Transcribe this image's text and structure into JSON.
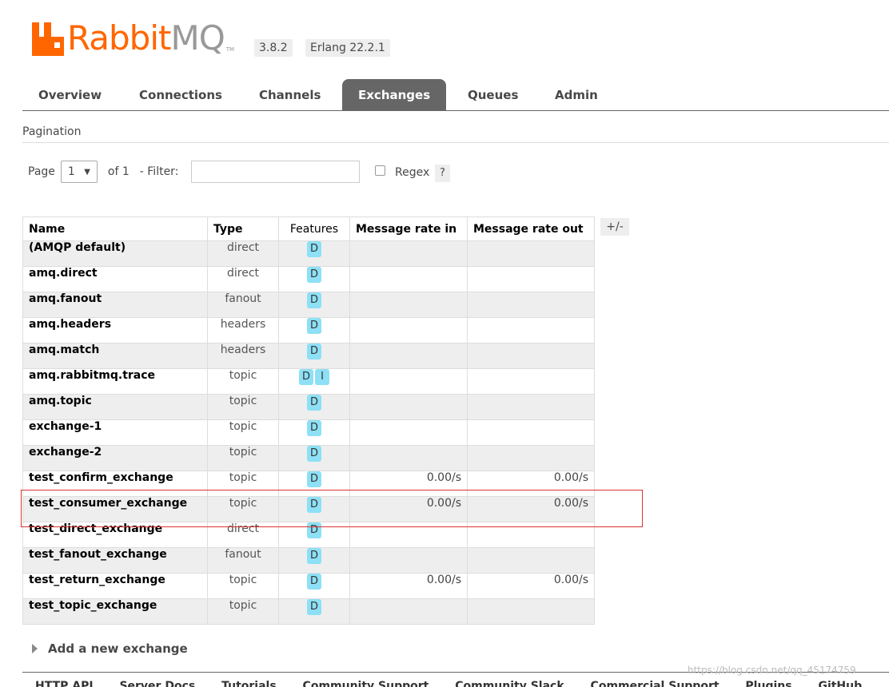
{
  "logo": {
    "rabbit": "Rabbit",
    "mq": "MQ",
    "tm": "TM"
  },
  "versions": {
    "rabbitmq": "3.8.2",
    "erlang": "Erlang 22.2.1"
  },
  "tabs": [
    {
      "label": "Overview",
      "active": false
    },
    {
      "label": "Connections",
      "active": false
    },
    {
      "label": "Channels",
      "active": false
    },
    {
      "label": "Exchanges",
      "active": true
    },
    {
      "label": "Queues",
      "active": false
    },
    {
      "label": "Admin",
      "active": false
    }
  ],
  "pagination": {
    "title": "Pagination",
    "page_label": "Page",
    "page_value": "1",
    "of_label": "of 1",
    "filter_label": "- Filter:",
    "filter_value": "",
    "regex_label": "Regex",
    "regex_checked": false,
    "help_label": "?"
  },
  "table": {
    "columns": [
      "Name",
      "Type",
      "Features",
      "Message rate in",
      "Message rate out"
    ],
    "toggle_columns": "+/-",
    "rows": [
      {
        "name": "(AMQP default)",
        "type": "direct",
        "features": [
          "D"
        ],
        "rate_in": "",
        "rate_out": ""
      },
      {
        "name": "amq.direct",
        "type": "direct",
        "features": [
          "D"
        ],
        "rate_in": "",
        "rate_out": ""
      },
      {
        "name": "amq.fanout",
        "type": "fanout",
        "features": [
          "D"
        ],
        "rate_in": "",
        "rate_out": ""
      },
      {
        "name": "amq.headers",
        "type": "headers",
        "features": [
          "D"
        ],
        "rate_in": "",
        "rate_out": ""
      },
      {
        "name": "amq.match",
        "type": "headers",
        "features": [
          "D"
        ],
        "rate_in": "",
        "rate_out": ""
      },
      {
        "name": "amq.rabbitmq.trace",
        "type": "topic",
        "features": [
          "D",
          "I"
        ],
        "rate_in": "",
        "rate_out": ""
      },
      {
        "name": "amq.topic",
        "type": "topic",
        "features": [
          "D"
        ],
        "rate_in": "",
        "rate_out": ""
      },
      {
        "name": "exchange-1",
        "type": "topic",
        "features": [
          "D"
        ],
        "rate_in": "",
        "rate_out": ""
      },
      {
        "name": "exchange-2",
        "type": "topic",
        "features": [
          "D"
        ],
        "rate_in": "",
        "rate_out": ""
      },
      {
        "name": "test_confirm_exchange",
        "type": "topic",
        "features": [
          "D"
        ],
        "rate_in": "0.00/s",
        "rate_out": "0.00/s"
      },
      {
        "name": "test_consumer_exchange",
        "type": "topic",
        "features": [
          "D"
        ],
        "rate_in": "0.00/s",
        "rate_out": "0.00/s"
      },
      {
        "name": "test_direct_exchange",
        "type": "direct",
        "features": [
          "D"
        ],
        "rate_in": "",
        "rate_out": ""
      },
      {
        "name": "test_fanout_exchange",
        "type": "fanout",
        "features": [
          "D"
        ],
        "rate_in": "",
        "rate_out": ""
      },
      {
        "name": "test_return_exchange",
        "type": "topic",
        "features": [
          "D"
        ],
        "rate_in": "0.00/s",
        "rate_out": "0.00/s"
      },
      {
        "name": "test_topic_exchange",
        "type": "topic",
        "features": [
          "D"
        ],
        "rate_in": "",
        "rate_out": ""
      }
    ]
  },
  "add_exchange_label": "Add a new exchange",
  "footer_links": [
    "HTTP API",
    "Server Docs",
    "Tutorials",
    "Community Support",
    "Community Slack",
    "Commercial Support",
    "Plugins",
    "GitHub"
  ],
  "watermark": "https://blog.csdn.net/qq_45174759",
  "colors": {
    "brand_orange": "#ff6600",
    "tab_active": "#666666",
    "feature_badge": "#8de0f5",
    "highlight_box": "#dd3333"
  }
}
